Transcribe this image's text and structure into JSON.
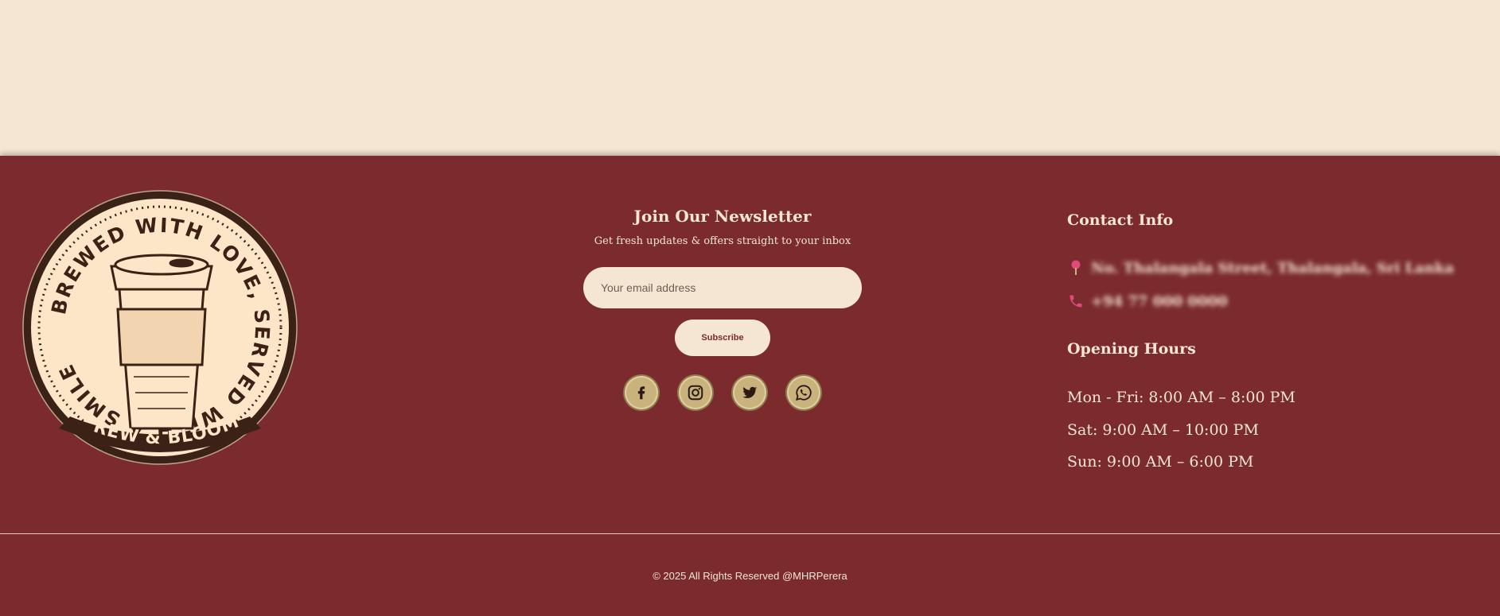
{
  "logo": {
    "ring_text": "BREWED WITH LOVE, SERVED WITH A SMILE",
    "brand": "BREW & BLOOM"
  },
  "newsletter": {
    "title": "Join Our Newsletter",
    "subtitle": "Get fresh updates & offers straight to your inbox",
    "email_placeholder": "Your email address",
    "subscribe_label": "Subscribe"
  },
  "socials": [
    {
      "icon": "facebook-icon"
    },
    {
      "icon": "instagram-icon"
    },
    {
      "icon": "twitter-icon"
    },
    {
      "icon": "whatsapp-icon"
    }
  ],
  "contact": {
    "title": "Contact Info",
    "address": "No. Thalangala Street, Thalangala, Sri Lanka",
    "phone": "+94 77 000 0000"
  },
  "hours": {
    "title": "Opening Hours",
    "lines": [
      "Mon - Fri: 8:00 AM – 8:00 PM",
      "Sat: 9:00 AM – 10:00 PM",
      "Sun: 9:00 AM – 6:00 PM"
    ]
  },
  "footer": {
    "copyright": "© 2025 All Rights Reserved @MHRPerera"
  },
  "colors": {
    "cream": "#f5e6d3",
    "maroon": "#7b2b2e",
    "gold": "#c9b27c",
    "pin": "#e04a7a"
  }
}
